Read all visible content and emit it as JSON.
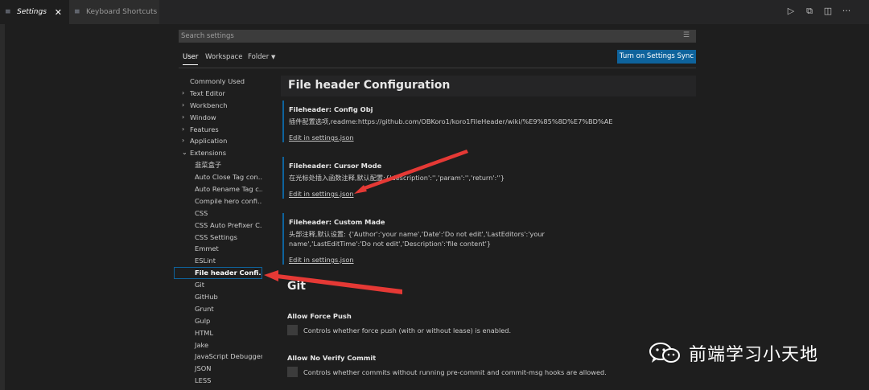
{
  "tabs": [
    {
      "label": "Settings",
      "icon": "settings-file-icon"
    },
    {
      "label": "Keyboard Shortcuts",
      "icon": "keyboard-file-icon"
    }
  ],
  "top_actions": [
    "run-icon",
    "open-json-icon",
    "split-editor-icon",
    "more-icon"
  ],
  "search": {
    "placeholder": "Search settings"
  },
  "scope": {
    "user": "User",
    "workspace": "Workspace",
    "folder": "Folder",
    "sync_button": "Turn on Settings Sync"
  },
  "toc": [
    {
      "label": "Commonly Used",
      "level": 1,
      "expandable": false
    },
    {
      "label": "Text Editor",
      "level": 1,
      "expandable": true
    },
    {
      "label": "Workbench",
      "level": 1,
      "expandable": true
    },
    {
      "label": "Window",
      "level": 1,
      "expandable": true
    },
    {
      "label": "Features",
      "level": 1,
      "expandable": true
    },
    {
      "label": "Application",
      "level": 1,
      "expandable": true
    },
    {
      "label": "Extensions",
      "level": 1,
      "expandable": true,
      "expanded": true
    },
    {
      "label": "韭菜盒子",
      "level": 2
    },
    {
      "label": "Auto Close Tag con...",
      "level": 2
    },
    {
      "label": "Auto Rename Tag c...",
      "level": 2
    },
    {
      "label": "Compile hero confi...",
      "level": 2
    },
    {
      "label": "CSS",
      "level": 2
    },
    {
      "label": "CSS Auto Prefixer C...",
      "level": 2
    },
    {
      "label": "CSS Settings",
      "level": 2
    },
    {
      "label": "Emmet",
      "level": 2
    },
    {
      "label": "ESLint",
      "level": 2
    },
    {
      "label": "File header Confi...",
      "level": 2,
      "selected": true
    },
    {
      "label": "Git",
      "level": 2
    },
    {
      "label": "GitHub",
      "level": 2
    },
    {
      "label": "Grunt",
      "level": 2
    },
    {
      "label": "Gulp",
      "level": 2
    },
    {
      "label": "HTML",
      "level": 2
    },
    {
      "label": "Jake",
      "level": 2
    },
    {
      "label": "JavaScript Debugger",
      "level": 2
    },
    {
      "label": "JSON",
      "level": 2
    },
    {
      "label": "LESS",
      "level": 2
    }
  ],
  "section": {
    "title": "File header Configuration"
  },
  "settings": [
    {
      "title": "Fileheader: Config Obj",
      "desc": "插件配置选项,readme:https://github.com/OBKoro1/koro1FileHeader/wiki/%E9%85%8D%E7%BD%AE",
      "link": "Edit in settings.json"
    },
    {
      "title": "Fileheader: Cursor Mode",
      "desc": "在光标处插入函数注释,默认配置:{'description':'','param':'','return':''}",
      "link": "Edit in settings.json"
    },
    {
      "title": "Fileheader: Custom Made",
      "desc": "头部注释,默认设置: {'Author':'your name','Date':'Do not edit','LastEditors':'your name','LastEditTime':'Do not edit','Description':'file content'}",
      "link": "Edit in settings.json"
    }
  ],
  "git": {
    "title": "Git",
    "force_push": {
      "title": "Allow Force Push",
      "desc": "Controls whether force push (with or without lease) is enabled."
    },
    "no_verify": {
      "title": "Allow No Verify Commit",
      "desc": "Controls whether commits without running pre-commit and commit-msg hooks are allowed."
    }
  },
  "watermark": {
    "text": "前端学习小天地",
    "icon": "wechat-logo-icon"
  },
  "annotation_color": "#e53935"
}
